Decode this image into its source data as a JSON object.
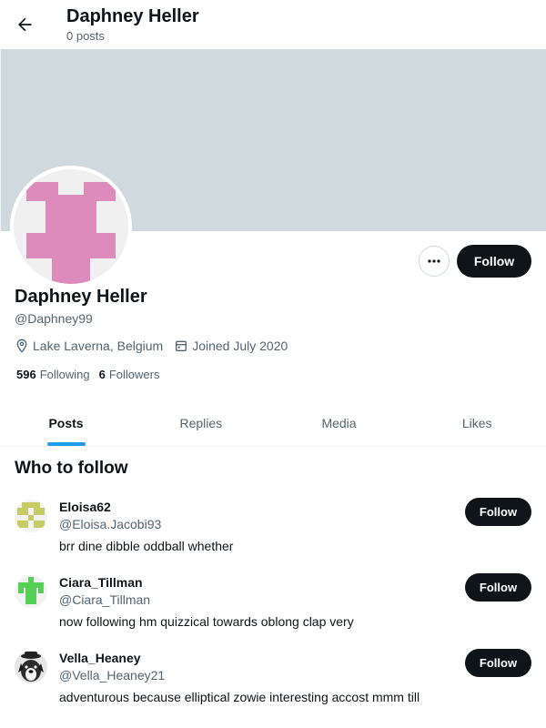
{
  "header": {
    "title": "Daphney Heller",
    "subtitle": "0 posts"
  },
  "profile": {
    "name": "Daphney Heller",
    "handle": "@Daphney99",
    "location": "Lake Laverna, Belgium",
    "joined": "Joined July 2020",
    "following_count": "596",
    "following_label": "Following",
    "followers_count": "6",
    "followers_label": "Followers",
    "follow_label": "Follow",
    "banner_color": "#cfd9de",
    "avatar_color": "#dd8bbb"
  },
  "tabs": [
    {
      "label": "Posts",
      "active": true
    },
    {
      "label": "Replies",
      "active": false
    },
    {
      "label": "Media",
      "active": false
    },
    {
      "label": "Likes",
      "active": false
    }
  ],
  "who_to_follow": {
    "title": "Who to follow",
    "items": [
      {
        "name": "Eloisa62",
        "handle": "@Eloisa.Jacobi93",
        "bio": "brr dine dibble oddball whether",
        "follow_label": "Follow",
        "avatar_color": "#c5cc63"
      },
      {
        "name": "Ciara_Tillman",
        "handle": "@Ciara_Tillman",
        "bio": "now following hm quizzical towards oblong clap very",
        "follow_label": "Follow",
        "avatar_color": "#55d15a"
      },
      {
        "name": "Vella_Heaney",
        "handle": "@Vella_Heaney21",
        "bio": "adventurous because elliptical zowie interesting accost mmm till",
        "follow_label": "Follow",
        "avatar_color": "#333333"
      }
    ]
  },
  "colors": {
    "accent": "#1d9bf0",
    "text": "#0f1419",
    "muted": "#536471"
  }
}
